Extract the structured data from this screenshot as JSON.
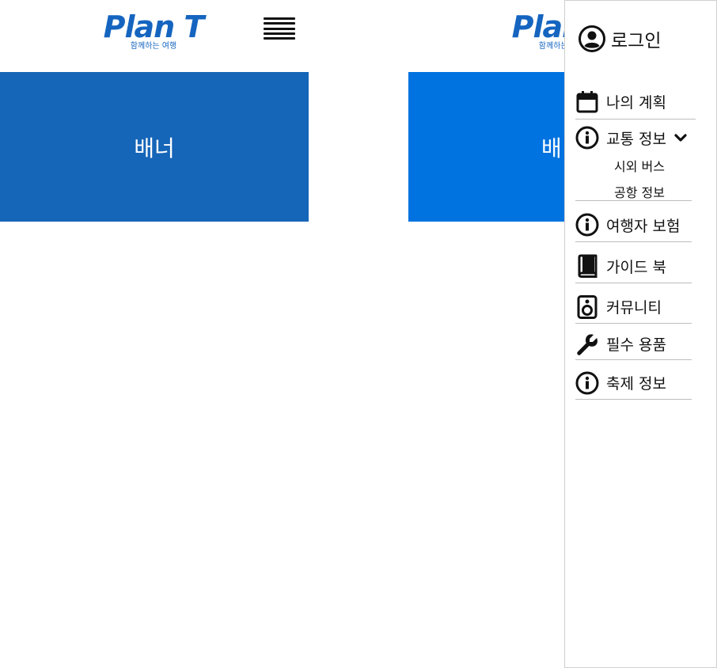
{
  "logo": {
    "title": "Plan T",
    "subtitle": "함께하는 여행"
  },
  "banner": {
    "label": "배너",
    "label_partial": "배"
  },
  "drawer": {
    "login_label": "로그인",
    "items": [
      {
        "label": "나의 계획",
        "icon": "calendar-icon"
      },
      {
        "label": "교통 정보",
        "icon": "info-icon"
      },
      {
        "label": "여행자 보험",
        "icon": "info-icon"
      },
      {
        "label": "가이드 북",
        "icon": "book-icon"
      },
      {
        "label": "커뮤니티",
        "icon": "speaker-icon"
      },
      {
        "label": "필수 용품",
        "icon": "wrench-icon"
      },
      {
        "label": "축제 정보",
        "icon": "info-icon"
      }
    ],
    "transport_sub": [
      "시외 버스",
      "공항 정보"
    ]
  },
  "colors": {
    "brand": "#1565c0",
    "banner_left": "#1565b8",
    "banner_right": "#0073e0"
  }
}
